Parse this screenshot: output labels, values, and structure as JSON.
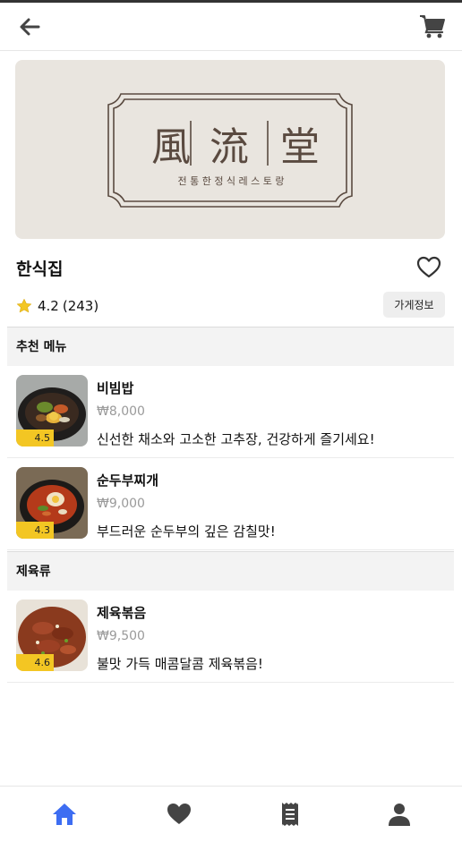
{
  "header": {
    "back_icon": "arrow-left-icon",
    "cart_icon": "shopping-cart-icon"
  },
  "banner": {
    "logo_hanja": [
      "風",
      "流",
      "堂"
    ],
    "logo_subtitle": "전 통 한 정 식 레 스 토 랑"
  },
  "store": {
    "name": "한식집",
    "rating": "4.2",
    "review_count": "(243)",
    "info_button_label": "가게정보",
    "favorite_icon": "heart-outline-icon"
  },
  "sections": [
    {
      "title": "추천 메뉴",
      "items": [
        {
          "name": "비빔밥",
          "price": "₩8,000",
          "description": "신선한 채소와 고소한 고추장, 건강하게 즐기세요!",
          "rating": "4.5"
        },
        {
          "name": "순두부찌개",
          "price": "₩9,000",
          "description": "부드러운 순두부의 깊은 감칠맛!",
          "rating": "4.3"
        }
      ]
    },
    {
      "title": "제육류",
      "items": [
        {
          "name": "제육볶음",
          "price": "₩9,500",
          "description": "불맛 가득 매콤달콤 제육볶음!",
          "rating": "4.6"
        }
      ]
    }
  ],
  "tabbar": {
    "items": [
      "home-icon",
      "heart-icon",
      "receipt-icon",
      "user-icon"
    ],
    "active": "home-icon",
    "active_color": "#3d6df2",
    "inactive_color": "#444444"
  },
  "colors": {
    "badge": "#f3c623",
    "star": "#f3c623",
    "banner_bg": "#e9e5df",
    "logo_ink": "#5a4a40"
  }
}
